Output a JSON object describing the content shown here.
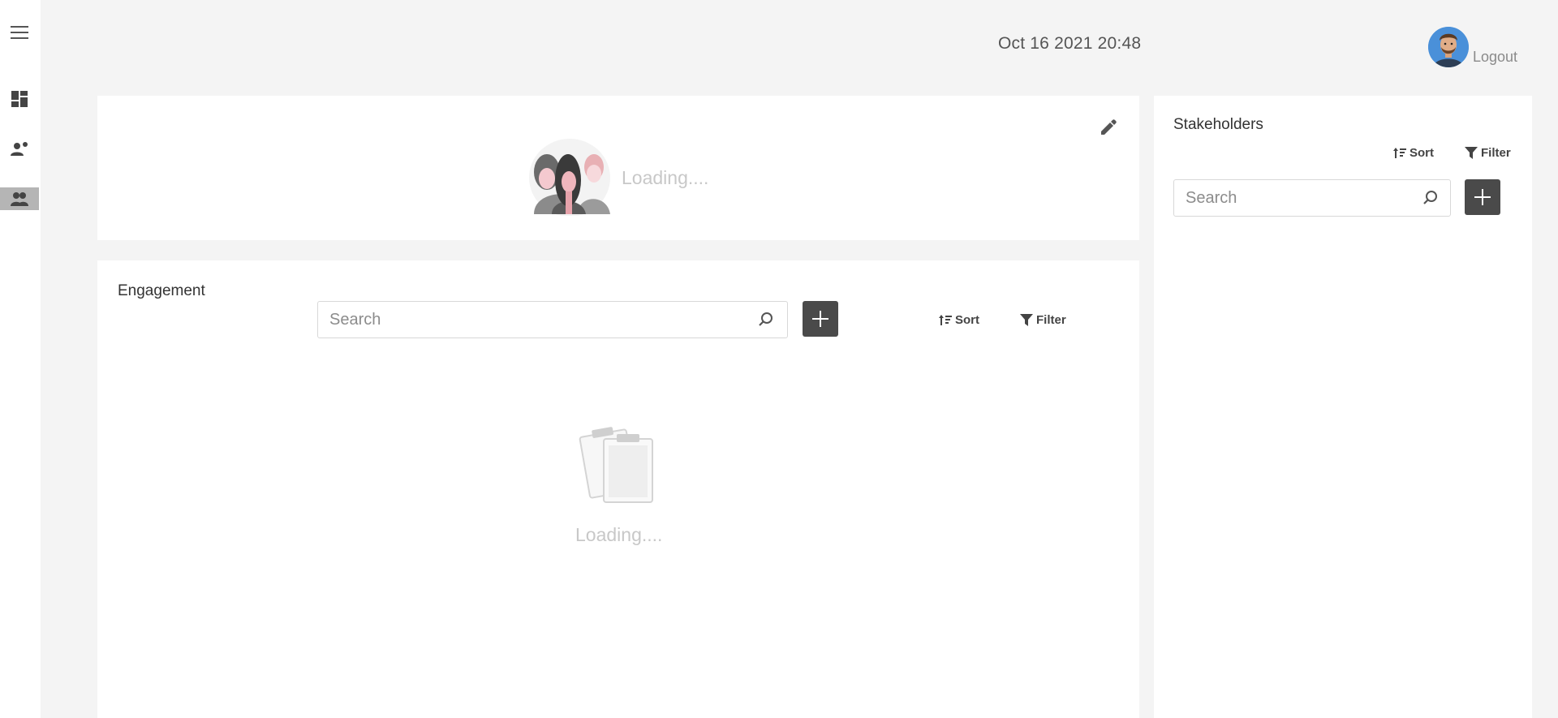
{
  "sidebar": {
    "menu_icon": "hamburger-menu-icon",
    "items": [
      {
        "icon": "dashboard-icon",
        "active": false
      },
      {
        "icon": "person-add-icon",
        "active": false
      },
      {
        "icon": "people-icon",
        "active": true
      }
    ]
  },
  "header": {
    "datetime": "Oct 16 2021  20:48",
    "logout_label": "Logout"
  },
  "top_card": {
    "loading_text": "Loading...."
  },
  "engagement": {
    "title": "Engagement",
    "search_placeholder": "Search",
    "sort_label": "Sort",
    "filter_label": "Filter",
    "loading_text": "Loading...."
  },
  "stakeholders": {
    "title": "Stakeholders",
    "sort_label": "Sort",
    "filter_label": "Filter",
    "search_placeholder": "Search"
  },
  "colors": {
    "accent_button": "#4a4a4a",
    "sidebar_active": "#b5b5b5",
    "background": "#f4f4f4"
  }
}
